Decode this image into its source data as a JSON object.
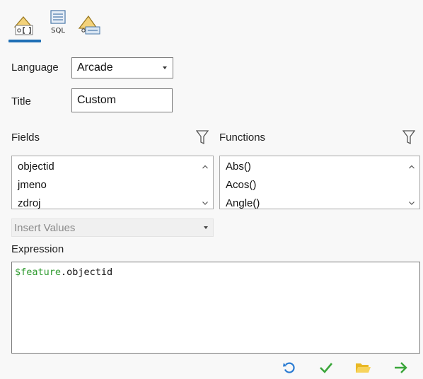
{
  "tabs": [
    {
      "icon": "python-expression-icon",
      "label": ""
    },
    {
      "icon": "sql-expression-icon",
      "label": "SQL"
    },
    {
      "icon": "arcade-expression-icon",
      "label": ""
    }
  ],
  "language": {
    "label": "Language",
    "value": "Arcade"
  },
  "title": {
    "label": "Title",
    "value": "Custom"
  },
  "fields": {
    "label": "Fields",
    "items": [
      "objectid",
      "jmeno",
      "zdroj"
    ]
  },
  "functions": {
    "label": "Functions",
    "items": [
      "Abs()",
      "Acos()",
      "Angle()"
    ]
  },
  "insert_values": {
    "placeholder": "Insert Values"
  },
  "expression": {
    "label": "Expression",
    "keyword": "$feature",
    "rest": ".objectid"
  },
  "colors": {
    "accent": "#1f6fb5",
    "keyword_green": "#2e9a2e",
    "verify_green": "#3aa63a",
    "folder_yellow": "#f2c12e",
    "undo_blue": "#2b7cd3"
  },
  "toolbar_icons": [
    "undo-icon",
    "verify-check-icon",
    "open-folder-icon",
    "apply-arrow-icon"
  ]
}
